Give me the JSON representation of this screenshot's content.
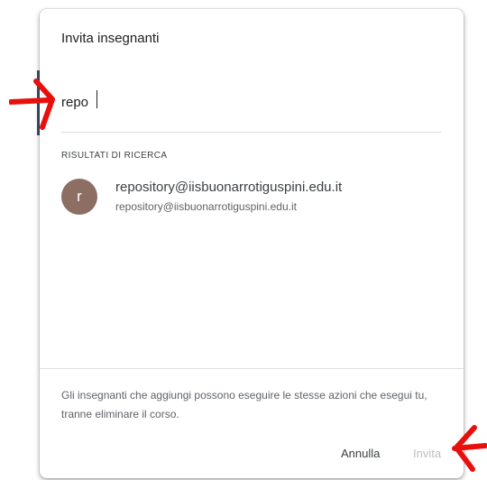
{
  "dialog": {
    "title": "Invita insegnanti",
    "search": {
      "value": "repo",
      "placeholder": ""
    },
    "results_header": "RISULTATI DI RICERCA",
    "results": [
      {
        "avatar_letter": "r",
        "avatar_color": "#8d6e63",
        "name": "repository@iisbuonarrotiguspini.edu.it",
        "email": "repository@iisbuonarrotiguspini.edu.it"
      }
    ],
    "info_text": "Gli insegnanti che aggiungi possono eseguire le stesse azioni che esegui tu, tranne eliminare il corso.",
    "cancel_label": "Annulla",
    "invite_label": "Invita"
  },
  "colors": {
    "annotation": "#e8100c",
    "disabled_text": "#bdc1c6",
    "avatar": "#8d6e63"
  }
}
